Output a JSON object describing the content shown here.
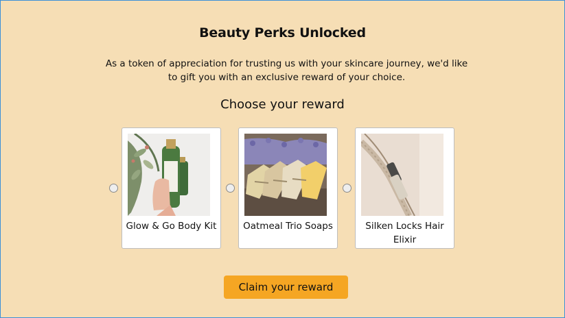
{
  "title": "Beauty Perks Unlocked",
  "subtitle": "As a token of appreciation for trusting us with your skincare journey, we'd like to gift you with an exclusive reward of your choice.",
  "choose_heading": "Choose your reward",
  "rewards": [
    {
      "label": "Glow & Go Body Kit",
      "image": "body-kit-product-photo"
    },
    {
      "label": "Oatmeal Trio Soaps",
      "image": "soaps-product-photo"
    },
    {
      "label": "Silken Locks Hair Elixir",
      "image": "hair-elixir-product-photo"
    }
  ],
  "claim_button": "Claim your reward",
  "colors": {
    "background": "#f6deb5",
    "button": "#f5a623",
    "frame_border": "#3a8fd8"
  }
}
